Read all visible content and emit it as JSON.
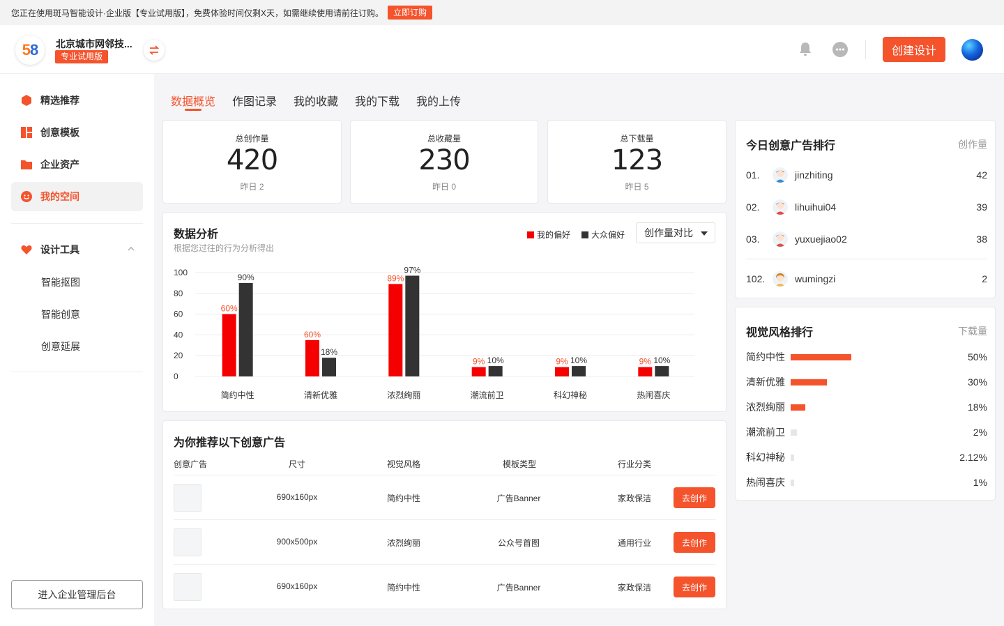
{
  "trial_banner": {
    "text": "您正在使用斑马智能设计·企业版【专业试用版】，免费体验时间仅剩X天，如需继续使用请前往订购。",
    "button": "立即订购"
  },
  "header": {
    "company": "北京城市网邻技...",
    "tag": "专业试用版",
    "create_button": "创建设计"
  },
  "sidebar": {
    "items": [
      {
        "label": "精选推荐",
        "icon": "hexagon-icon"
      },
      {
        "label": "创意模板",
        "icon": "template-icon"
      },
      {
        "label": "企业资产",
        "icon": "folder-icon"
      },
      {
        "label": "我的空间",
        "icon": "smile-icon",
        "active": true
      }
    ],
    "tools": {
      "label": "设计工具",
      "icon": "heart-icon",
      "sub": [
        "智能抠图",
        "智能创意",
        "创意延展"
      ]
    },
    "admin_button": "进入企业管理后台"
  },
  "tabs": [
    "数据概览",
    "作图记录",
    "我的收藏",
    "我的下载",
    "我的上传"
  ],
  "stats": [
    {
      "label": "总创作量",
      "value": "420",
      "sub": "昨日 2"
    },
    {
      "label": "总收藏量",
      "value": "230",
      "sub": "昨日 0"
    },
    {
      "label": "总下载量",
      "value": "123",
      "sub": "昨日 5"
    }
  ],
  "analysis": {
    "title": "数据分析",
    "subtitle": "根据您过往的行为分析得出",
    "dropdown": "创作量对比"
  },
  "chart_data": {
    "type": "bar",
    "categories": [
      "简约中性",
      "清新优雅",
      "浓烈绚丽",
      "潮流前卫",
      "科幻神秘",
      "热闹喜庆"
    ],
    "series": [
      {
        "name": "我的偏好",
        "values": [
          60,
          35,
          89,
          9,
          9,
          9
        ],
        "labels": [
          "60%",
          "60%",
          "89%",
          "9%",
          "9%",
          "9%"
        ],
        "color": "#f40000",
        "label_color": "#f4532c"
      },
      {
        "name": "大众偏好",
        "values": [
          90,
          18,
          97,
          10,
          10,
          10
        ],
        "labels": [
          "90%",
          "18%",
          "97%",
          "10%",
          "10%",
          "10%"
        ],
        "color": "#333333",
        "label_color": "#333333"
      }
    ],
    "yticks": [
      "100",
      "80",
      "60",
      "40",
      "20",
      "0"
    ],
    "ylim": [
      0,
      100
    ],
    "legend_placement": "top-right",
    "grid": true
  },
  "recommend": {
    "title": "为你推荐以下创意广告",
    "headers": [
      "创意广告",
      "尺寸",
      "视觉风格",
      "模板类型",
      "行业分类"
    ],
    "rows": [
      {
        "size": "690x160px",
        "style": "简约中性",
        "type": "广告Banner",
        "industry": "家政保洁",
        "action": "去创作"
      },
      {
        "size": "900x500px",
        "style": "浓烈绚丽",
        "type": "公众号首图",
        "industry": "通用行业",
        "action": "去创作"
      },
      {
        "size": "690x160px",
        "style": "简约中性",
        "type": "广告Banner",
        "industry": "家政保洁",
        "action": "去创作"
      }
    ]
  },
  "ranking": {
    "title": "今日创意广告排行",
    "metric": "创作量",
    "rows": [
      {
        "rank": "01.",
        "name": "jinzhiting",
        "value": "42"
      },
      {
        "rank": "02.",
        "name": "lihuihui04",
        "value": "39"
      },
      {
        "rank": "03.",
        "name": "yuxuejiao02",
        "value": "38"
      },
      {
        "rank": "102.",
        "name": "wumingzi",
        "value": "2"
      }
    ]
  },
  "style_rank": {
    "title": "视觉风格排行",
    "metric": "下载量",
    "rows": [
      {
        "name": "简约中性",
        "value": "50%",
        "fraction": 0.5,
        "color": "#f4532c"
      },
      {
        "name": "清新优雅",
        "value": "30%",
        "fraction": 0.3,
        "color": "#f4532c"
      },
      {
        "name": "浓烈绚丽",
        "value": "18%",
        "fraction": 0.12,
        "color": "#f4532c"
      },
      {
        "name": "潮流前卫",
        "value": "2%",
        "fraction": 0.05,
        "color": "#e6e6e6"
      },
      {
        "name": "科幻神秘",
        "value": "2.12%",
        "fraction": 0.03,
        "color": "#e6e6e6"
      },
      {
        "name": "热闹喜庆",
        "value": "1%",
        "fraction": 0.03,
        "color": "#e6e6e6"
      }
    ]
  }
}
